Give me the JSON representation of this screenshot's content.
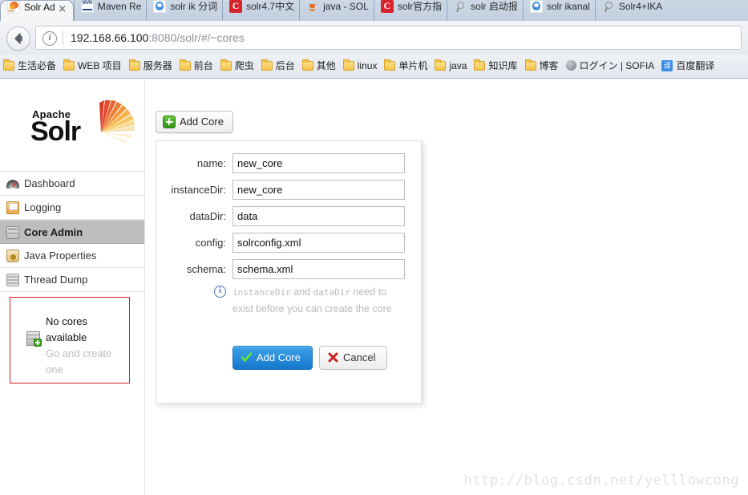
{
  "browser": {
    "back_button": "back-arrow",
    "security_icon": "info",
    "url_host": "192.168.66.100",
    "url_rest": ":8080/solr/#/~cores",
    "tabs": [
      {
        "label": "Solr Ad",
        "icon": "solr-favicon",
        "active": true,
        "close": "×"
      },
      {
        "label": "Maven Re",
        "icon": "maven-favicon",
        "active": false
      },
      {
        "label": "solr ik 分词",
        "icon": "baidu-favicon",
        "active": false
      },
      {
        "label": "solr4.7中文",
        "icon": "csdn-favicon",
        "active": false
      },
      {
        "label": "java - SOL",
        "icon": "java-favicon",
        "active": false
      },
      {
        "label": "solr官方指",
        "icon": "csdn-favicon",
        "active": false
      },
      {
        "label": "solr 启动报",
        "icon": "search-favicon",
        "active": false
      },
      {
        "label": "solr ikanal",
        "icon": "baidu-favicon",
        "active": false
      },
      {
        "label": "Solr4+IKA",
        "icon": "search-favicon",
        "active": false
      }
    ],
    "bookmarks": [
      {
        "label": "生活必备",
        "icon": "folder-icon"
      },
      {
        "label": "WEB 项目",
        "icon": "folder-icon"
      },
      {
        "label": "服务器",
        "icon": "folder-icon"
      },
      {
        "label": "前台",
        "icon": "folder-icon"
      },
      {
        "label": "爬虫",
        "icon": "folder-icon"
      },
      {
        "label": "后台",
        "icon": "folder-icon"
      },
      {
        "label": "其他",
        "icon": "folder-icon"
      },
      {
        "label": "linux",
        "icon": "folder-icon"
      },
      {
        "label": "单片机",
        "icon": "folder-icon"
      },
      {
        "label": "java",
        "icon": "folder-icon"
      },
      {
        "label": "知识库",
        "icon": "folder-icon"
      },
      {
        "label": "博客",
        "icon": "folder-icon"
      },
      {
        "label": "ログイン | SOFIA",
        "icon": "globe-icon"
      },
      {
        "label": "百度翻译",
        "icon": "translate-icon",
        "icon_glyph": "译"
      }
    ]
  },
  "sidebar": {
    "logo": {
      "apache": "Apache",
      "product": "Solr",
      "burst": "solr-sunburst-icon"
    },
    "items": [
      {
        "label": "Dashboard",
        "icon": "dashboard-icon",
        "selected": false
      },
      {
        "label": "Logging",
        "icon": "logging-icon",
        "selected": false
      },
      {
        "label": "Core Admin",
        "icon": "core-admin-icon",
        "selected": true
      },
      {
        "label": "Java Properties",
        "icon": "java-properties-icon",
        "selected": false
      },
      {
        "label": "Thread Dump",
        "icon": "thread-dump-icon",
        "selected": false
      }
    ],
    "no_cores": {
      "title_line1": "No cores",
      "title_line2": "available",
      "link_line1": "Go and create",
      "link_line2": "one",
      "icon": "core-add-icon",
      "border_color": "#d22020"
    }
  },
  "content": {
    "add_core_toolbar_label": "Add Core",
    "dialog": {
      "fields": [
        {
          "label": "name:",
          "value": "new_core",
          "name": "core-name"
        },
        {
          "label": "instanceDir:",
          "value": "new_core",
          "name": "instance-dir"
        },
        {
          "label": "dataDir:",
          "value": "data",
          "name": "data-dir"
        },
        {
          "label": "config:",
          "value": "solrconfig.xml",
          "name": "config-file"
        },
        {
          "label": "schema:",
          "value": "schema.xml",
          "name": "schema-file"
        }
      ],
      "hint": {
        "icon": "info-icon",
        "part1": "instanceDir",
        "part2": " and ",
        "part3": "dataDir",
        "part4": " need to exist before you can create the core"
      },
      "submit_label": "Add Core",
      "cancel_label": "Cancel",
      "submit_color": "#1477cd"
    }
  },
  "watermark": "http://blog.csdn.net/yelllowcong"
}
